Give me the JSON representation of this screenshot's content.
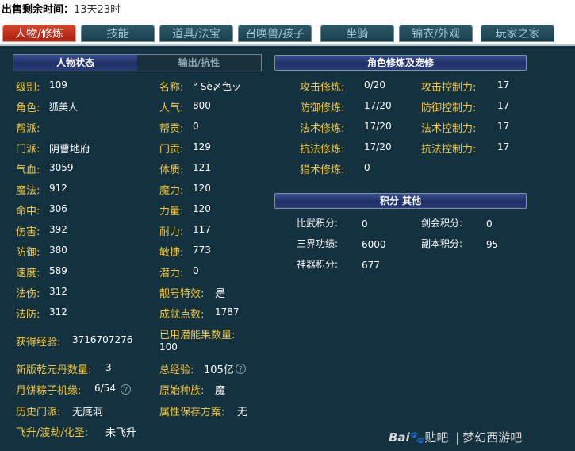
{
  "sale": {
    "label": "出售剩余时间：",
    "value": "13天23时"
  },
  "tabs": [
    {
      "label": "人物/修炼"
    },
    {
      "label": "技能"
    },
    {
      "label": "道具/法宝"
    },
    {
      "label": "召唤兽/孩子"
    },
    {
      "label": "坐骑"
    },
    {
      "label": "锦衣/外观"
    },
    {
      "label": "玩家之家"
    }
  ],
  "subtabs": {
    "status": "人物状态",
    "output": "输出/抗性"
  },
  "left_rows": [
    {
      "l1": "级别:",
      "v1": "109",
      "l2": "名称:",
      "v2": "° Sè〆色ッ"
    },
    {
      "l1": "角色:",
      "v1": "狐美人",
      "l2": "人气:",
      "v2": "800"
    },
    {
      "l1": "帮派:",
      "v1": "",
      "l2": "帮贡:",
      "v2": "0"
    },
    {
      "l1": "门派:",
      "v1": "阴曹地府",
      "l2": "门贡:",
      "v2": "129"
    },
    {
      "l1": "气血:",
      "v1": "3059",
      "l2": "体质:",
      "v2": "121"
    },
    {
      "l1": "魔法:",
      "v1": "912",
      "l2": "魔力:",
      "v2": "120"
    },
    {
      "l1": "命中:",
      "v1": "306",
      "l2": "力量:",
      "v2": "120"
    },
    {
      "l1": "伤害:",
      "v1": "392",
      "l2": "耐力:",
      "v2": "117"
    },
    {
      "l1": "防御:",
      "v1": "380",
      "l2": "敏捷:",
      "v2": "773"
    },
    {
      "l1": "速度:",
      "v1": "589",
      "l2": "潜力:",
      "v2": "0"
    },
    {
      "l1": "法伤:",
      "v1": "312",
      "l2": "靓号特效:",
      "v2": "是"
    },
    {
      "l1": "法防:",
      "v1": "312",
      "l2": "成就点数:",
      "v2": "1787"
    }
  ],
  "exp": {
    "label": "获得经验:",
    "value": "3716707276",
    "used_label": "已用潜能果数量:",
    "used_value": "100"
  },
  "bottom_rows": [
    {
      "l1": "新版乾元丹数量:",
      "v1": "3",
      "l2": "总经验:",
      "v2": "105亿"
    },
    {
      "l1": "月饼粽子机缘:",
      "v1": "6/54",
      "l2": "原始种族:",
      "v2": "魔"
    },
    {
      "l1": "历史门派:",
      "v1": "无底洞",
      "l2": "属性保存方案:",
      "v2": "无"
    },
    {
      "l1": "飞升/渡劫/化圣:",
      "v1": "未飞升"
    }
  ],
  "help_icon": "question-circle-icon",
  "cultivation": {
    "title": "角色修炼及宠修",
    "rows": [
      {
        "l1": "攻击修炼:",
        "v1": "0/20",
        "l2": "攻击控制力:",
        "v2": "17"
      },
      {
        "l1": "防御修炼:",
        "v1": "17/20",
        "l2": "防御控制力:",
        "v2": "17"
      },
      {
        "l1": "法术修炼:",
        "v1": "17/20",
        "l2": "法术控制力:",
        "v2": "17"
      },
      {
        "l1": "抗法修炼:",
        "v1": "17/20",
        "l2": "抗法控制力:",
        "v2": "17"
      },
      {
        "l1": "猎术修炼:",
        "v1": "0"
      }
    ]
  },
  "points": {
    "title": "积分 其他",
    "rows": [
      {
        "l1": "比武积分:",
        "v1": "0",
        "l2": "剑会积分:",
        "v2": "0"
      },
      {
        "l1": "三界功绩:",
        "v1": "6000",
        "l2": "副本积分:",
        "v2": "95"
      },
      {
        "l1": "神器积分:",
        "v1": "677"
      }
    ]
  },
  "watermark": {
    "brand": "Bai",
    "paw": "🐾",
    "tieba": "贴吧",
    "sep": "|",
    "game": "梦幻西游吧"
  },
  "colors": {
    "bg": "#13313e",
    "label": "#f3c83b",
    "active_tab": "#c8321c",
    "header": "#26367a"
  }
}
